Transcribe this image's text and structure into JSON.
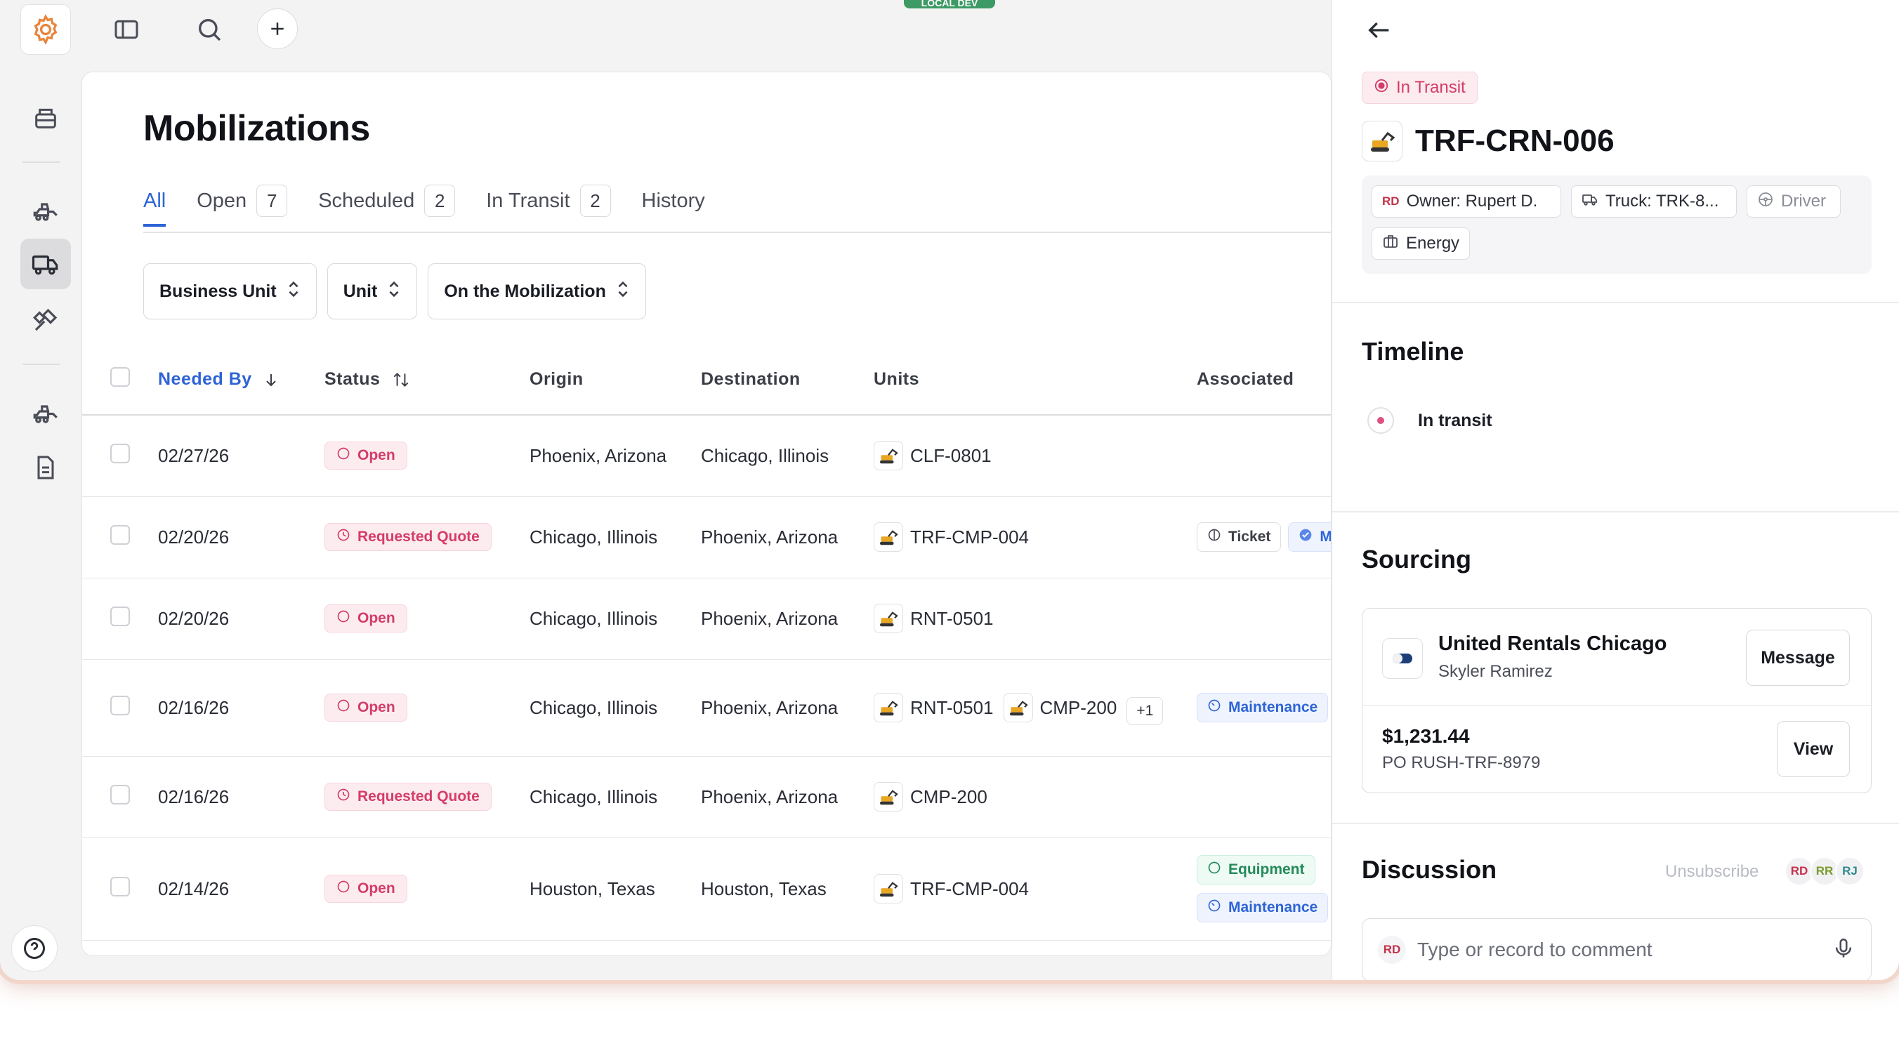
{
  "env_badge": "LOCAL DEV",
  "page": {
    "title": "Mobilizations",
    "tabs": [
      {
        "label": "All",
        "count": null
      },
      {
        "label": "Open",
        "count": "7"
      },
      {
        "label": "Scheduled",
        "count": "2"
      },
      {
        "label": "In Transit",
        "count": "2"
      },
      {
        "label": "History",
        "count": null
      }
    ],
    "filters": [
      "Business Unit",
      "Unit",
      "On the Mobilization"
    ],
    "columns": [
      "Needed By",
      "Status",
      "Origin",
      "Destination",
      "Units",
      "Associated"
    ],
    "rows": [
      {
        "date": "02/27/26",
        "status": "Open",
        "origin": "Phoenix, Arizona",
        "destination": "Chicago, Illinois",
        "units": [
          "CLF-0801"
        ],
        "more": "",
        "tags": []
      },
      {
        "date": "02/20/26",
        "status": "Requested Quote",
        "origin": "Chicago, Illinois",
        "destination": "Phoenix, Arizona",
        "units": [
          "TRF-CMP-004"
        ],
        "more": "",
        "tags": [
          "Ticket",
          "M"
        ]
      },
      {
        "date": "02/20/26",
        "status": "Open",
        "origin": "Chicago, Illinois",
        "destination": "Phoenix, Arizona",
        "units": [
          "RNT-0501"
        ],
        "more": "",
        "tags": []
      },
      {
        "date": "02/16/26",
        "status": "Open",
        "origin": "Chicago, Illinois",
        "destination": "Phoenix, Arizona",
        "units": [
          "RNT-0501",
          "CMP-200"
        ],
        "more": "+1",
        "tags": [
          "Maintenance"
        ]
      },
      {
        "date": "02/16/26",
        "status": "Requested Quote",
        "origin": "Chicago, Illinois",
        "destination": "Phoenix, Arizona",
        "units": [
          "CMP-200"
        ],
        "more": "",
        "tags": []
      },
      {
        "date": "02/14/26",
        "status": "Open",
        "origin": "Houston, Texas",
        "destination": "Houston, Texas",
        "units": [
          "TRF-CMP-004"
        ],
        "more": "",
        "tags": [
          "Equipment",
          "Maintenance"
        ]
      }
    ]
  },
  "panel": {
    "status": "In Transit",
    "asset_id": "TRF-CRN-006",
    "meta": {
      "owner_initials": "RD",
      "owner": "Owner: Rupert D.",
      "truck": "Truck: TRK-8...",
      "driver": "Driver",
      "business_unit": "Energy"
    },
    "timeline_title": "Timeline",
    "timeline_item": "In transit",
    "sourcing_title": "Sourcing",
    "vendor": "United Rentals Chicago",
    "contact": "Skyler Ramirez",
    "message_btn": "Message",
    "amount": "$1,231.44",
    "po": "PO RUSH-TRF-8979",
    "view_btn": "View",
    "discussion_title": "Discussion",
    "unsubscribe": "Unsubscribe",
    "watchers": [
      "RD",
      "RR",
      "RJ"
    ],
    "commenter": "RD",
    "comment_placeholder": "Type or record to comment"
  },
  "colors": {
    "accent": "#2e64d6",
    "status_pink": "#d43c6a",
    "brand_orange": "#e8843c"
  }
}
